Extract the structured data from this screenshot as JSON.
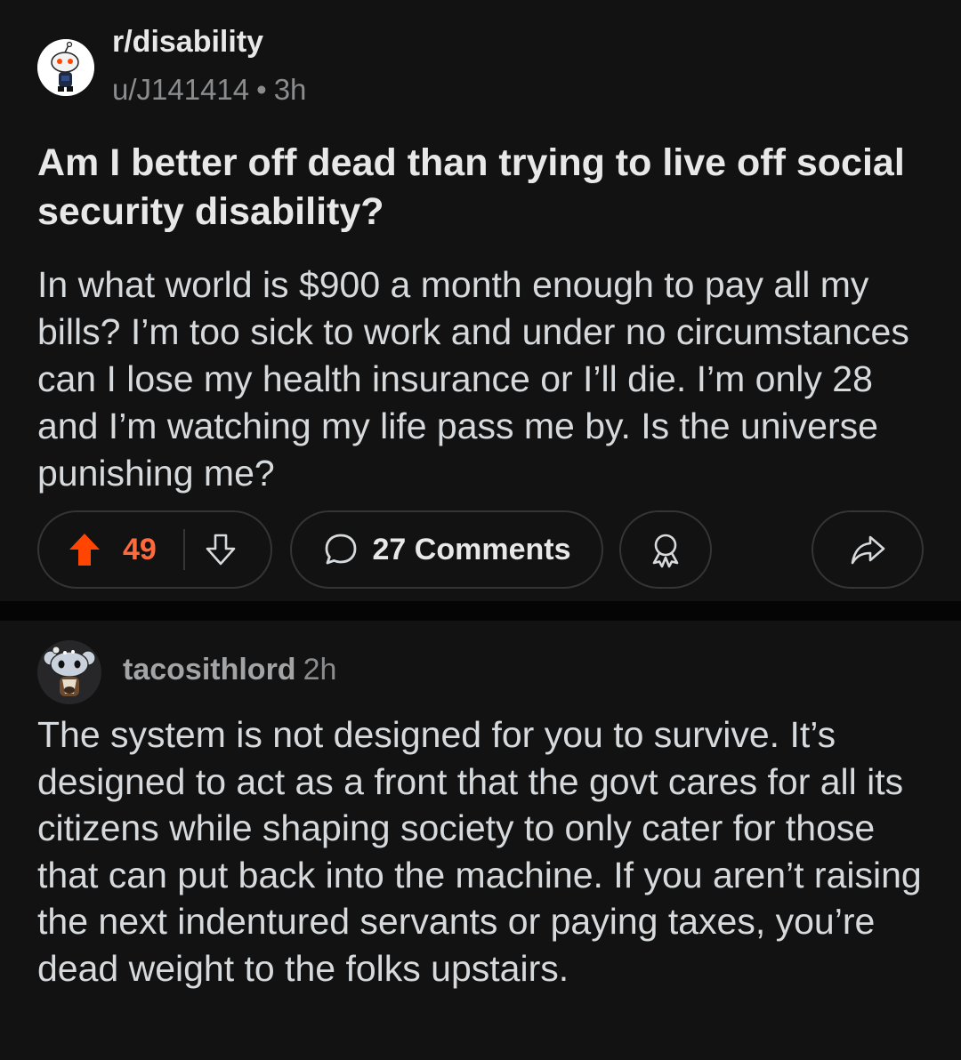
{
  "post": {
    "subreddit": "r/disability",
    "author": "u/J141414",
    "separator": "•",
    "age": "3h",
    "title": "Am I better off dead than trying to live off social security disability?",
    "body": "In what world is $900 a month enough to pay all my bills? I’m too sick to work and under no circumstances can I lose my health insurance or I’ll die. I’m only 28 and I’m watching my life pass me by. Is the universe punishing me?",
    "vote_count": "49",
    "comments_label": "27 Comments"
  },
  "comment": {
    "username": "tacosithlord",
    "age": "2h",
    "text": "The system is not designed for you to survive. It’s designed to act as a front that the govt cares for all its citizens while shaping society to only cater for those that can put back into the machine. If you aren’t raising the next indentured servants or paying taxes, you’re dead weight to the folks upstairs."
  },
  "icons": {
    "upvote": "upvote-arrow-icon",
    "downvote": "downvote-arrow-icon",
    "comments": "speech-bubble-icon",
    "award": "award-icon",
    "share": "share-arrow-icon"
  },
  "colors": {
    "background": "#121212",
    "divider": "#050505",
    "upvote_accent": "#ff4500",
    "vote_count": "#ff6a3c",
    "text": "#d7dadc",
    "muted": "#8a8c8e",
    "pill_border": "#343536"
  }
}
